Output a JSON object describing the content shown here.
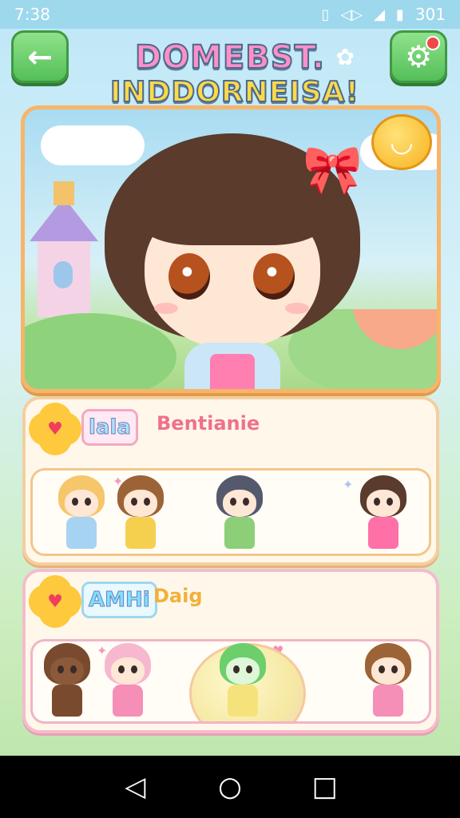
{
  "status_bar": {
    "time": "7:38",
    "right_text": "301",
    "icons": [
      "vibrate-icon",
      "signal-icon",
      "cell-signal-icon",
      "battery-icon"
    ]
  },
  "header": {
    "back_icon": "arrow-left-icon",
    "settings_icon": "gear-icon",
    "title_line1": "DOMEBST.",
    "title_line2": "INDDORNEISA!"
  },
  "hero": {
    "coin_icon": "orange-fruit-icon"
  },
  "lists": [
    {
      "tag": "lala",
      "subtitle": "Bentianie",
      "badge_icon": "heart-flower-icon"
    },
    {
      "tag": "AMHi",
      "subtitle": "Daig",
      "badge_icon": "heart-flower-icon"
    }
  ],
  "nav": {
    "back": "◁",
    "home": "○",
    "recents": "□"
  },
  "colors": {
    "accent_green": "#54bf59",
    "frame_orange": "#f7b56a",
    "frame_pink": "#f4bccc"
  }
}
